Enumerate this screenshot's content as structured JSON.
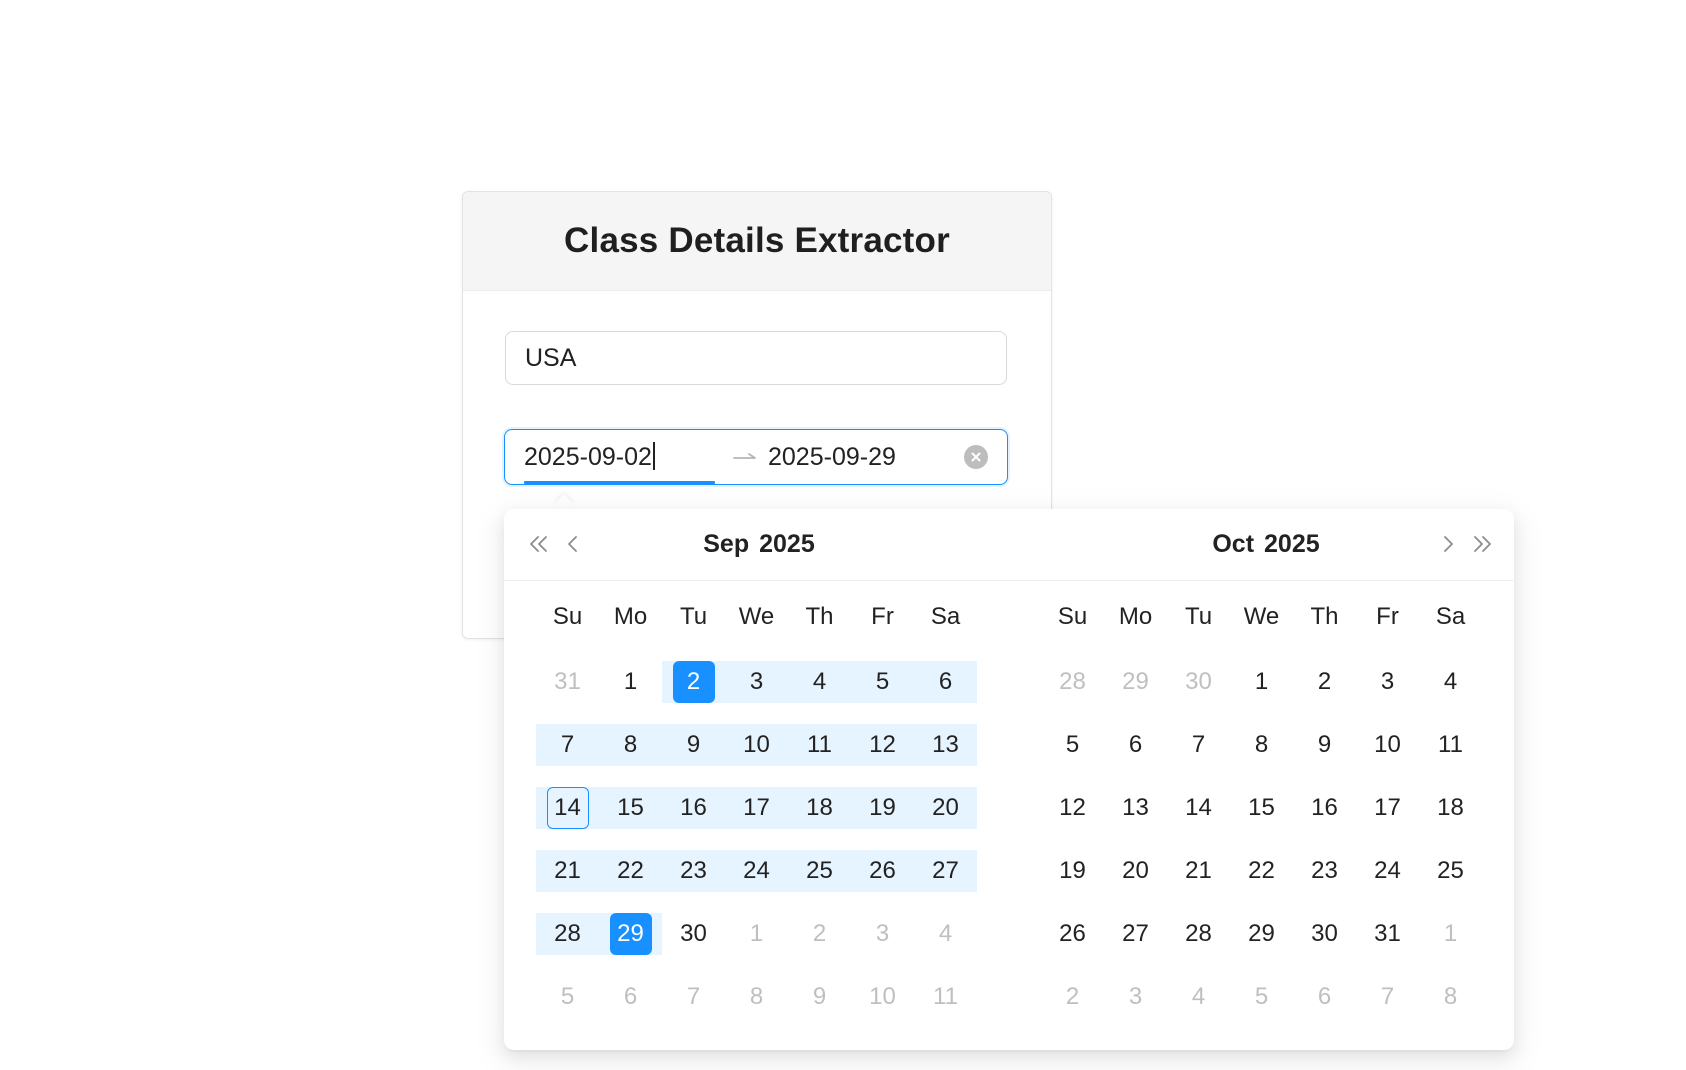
{
  "card": {
    "title": "Class Details Extractor"
  },
  "country_input": {
    "value": "USA"
  },
  "range_picker": {
    "start": "2025-09-02",
    "end": "2025-09-29"
  },
  "calendar": {
    "weekdays": [
      "Su",
      "Mo",
      "Tu",
      "We",
      "Th",
      "Fr",
      "Sa"
    ],
    "colors": {
      "accent": "#1890ff",
      "range_bg": "#e6f4ff",
      "muted": "#bfbfbf"
    },
    "left": {
      "month": "Sep",
      "year": "2025",
      "weeks": [
        [
          "31",
          "1",
          "2",
          "3",
          "4",
          "5",
          "6"
        ],
        [
          "7",
          "8",
          "9",
          "10",
          "11",
          "12",
          "13"
        ],
        [
          "14",
          "15",
          "16",
          "17",
          "18",
          "19",
          "20"
        ],
        [
          "21",
          "22",
          "23",
          "24",
          "25",
          "26",
          "27"
        ],
        [
          "28",
          "29",
          "30",
          "1",
          "2",
          "3",
          "4"
        ],
        [
          "5",
          "6",
          "7",
          "8",
          "9",
          "10",
          "11"
        ]
      ],
      "out_of_month": [
        [
          0,
          0
        ],
        [
          4,
          3
        ],
        [
          4,
          4
        ],
        [
          4,
          5
        ],
        [
          4,
          6
        ],
        [
          5,
          0
        ],
        [
          5,
          1
        ],
        [
          5,
          2
        ],
        [
          5,
          3
        ],
        [
          5,
          4
        ],
        [
          5,
          5
        ],
        [
          5,
          6
        ]
      ],
      "selected": [
        [
          0,
          2
        ],
        [
          4,
          1
        ]
      ],
      "in_range": [
        [
          0,
          2
        ],
        [
          0,
          3
        ],
        [
          0,
          4
        ],
        [
          0,
          5
        ],
        [
          0,
          6
        ],
        [
          1,
          0
        ],
        [
          1,
          1
        ],
        [
          1,
          2
        ],
        [
          1,
          3
        ],
        [
          1,
          4
        ],
        [
          1,
          5
        ],
        [
          1,
          6
        ],
        [
          2,
          0
        ],
        [
          2,
          1
        ],
        [
          2,
          2
        ],
        [
          2,
          3
        ],
        [
          2,
          4
        ],
        [
          2,
          5
        ],
        [
          2,
          6
        ],
        [
          3,
          0
        ],
        [
          3,
          1
        ],
        [
          3,
          2
        ],
        [
          3,
          3
        ],
        [
          3,
          4
        ],
        [
          3,
          5
        ],
        [
          3,
          6
        ],
        [
          4,
          0
        ],
        [
          4,
          1
        ]
      ],
      "today": [
        [
          2,
          0
        ]
      ]
    },
    "right": {
      "month": "Oct",
      "year": "2025",
      "weeks": [
        [
          "28",
          "29",
          "30",
          "1",
          "2",
          "3",
          "4"
        ],
        [
          "5",
          "6",
          "7",
          "8",
          "9",
          "10",
          "11"
        ],
        [
          "12",
          "13",
          "14",
          "15",
          "16",
          "17",
          "18"
        ],
        [
          "19",
          "20",
          "21",
          "22",
          "23",
          "24",
          "25"
        ],
        [
          "26",
          "27",
          "28",
          "29",
          "30",
          "31",
          "1"
        ],
        [
          "2",
          "3",
          "4",
          "5",
          "6",
          "7",
          "8"
        ]
      ],
      "out_of_month": [
        [
          0,
          0
        ],
        [
          0,
          1
        ],
        [
          0,
          2
        ],
        [
          4,
          6
        ],
        [
          5,
          0
        ],
        [
          5,
          1
        ],
        [
          5,
          2
        ],
        [
          5,
          3
        ],
        [
          5,
          4
        ],
        [
          5,
          5
        ],
        [
          5,
          6
        ]
      ],
      "selected": [],
      "in_range": [],
      "today": []
    }
  }
}
